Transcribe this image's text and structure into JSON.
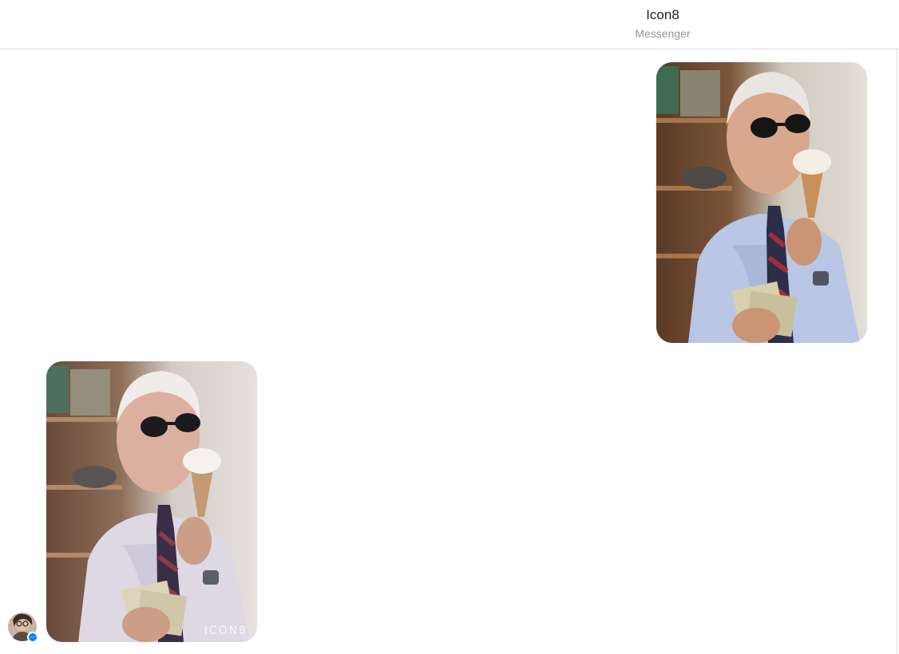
{
  "header": {
    "title": "Icon8",
    "subtitle": "Messenger"
  },
  "messages": [
    {
      "direction": "outgoing",
      "type": "photo",
      "icon": "photo-man-ice-cream"
    },
    {
      "direction": "incoming",
      "type": "photo",
      "icon": "photo-man-ice-cream-filtered",
      "watermark": "ICON8"
    }
  ],
  "contact_avatar": {
    "icon": "avatar-icon",
    "badge_icon": "messenger-badge-icon",
    "badge_color": "#0084ff"
  },
  "colors": {
    "accent": "#0084ff",
    "divider": "#dddfe2",
    "subtitle": "#90949c"
  }
}
